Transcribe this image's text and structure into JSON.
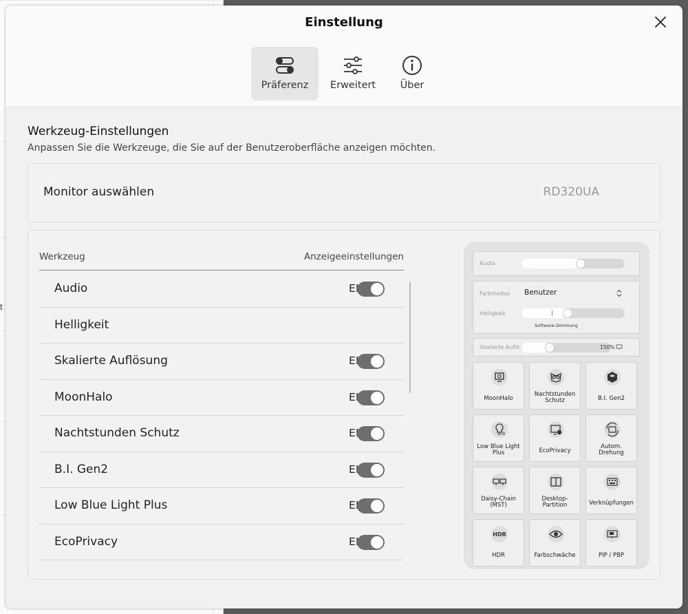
{
  "background": {
    "char": "t"
  },
  "dialog": {
    "title": "Einstellung",
    "tabs": [
      {
        "label": "Präferenz",
        "icon": "toggles-icon",
        "active": true
      },
      {
        "label": "Erweitert",
        "icon": "sliders-icon",
        "active": false
      },
      {
        "label": "Über",
        "icon": "info-icon",
        "active": false
      }
    ]
  },
  "section": {
    "title": "Werkzeug-Einstellungen",
    "subtitle": "Anpassen Sie die Werkzeuge, die Sie auf der Benutzeroberfläche anzeigen möchten."
  },
  "monitor": {
    "label": "Monitor auswählen",
    "value": "RD320UA"
  },
  "tools": {
    "header_left": "Werkzeug",
    "header_right": "Anzeigeeinstellungen",
    "rows": [
      {
        "name": "Audio",
        "state": "EIN",
        "toggle": true
      },
      {
        "name": "Helligkeit",
        "state": "",
        "toggle": false
      },
      {
        "name": "Skalierte Auflösung",
        "state": "EIN",
        "toggle": true
      },
      {
        "name": "MoonHalo",
        "state": "EIN",
        "toggle": true
      },
      {
        "name": "Nachtstunden Schutz",
        "state": "EIN",
        "toggle": true
      },
      {
        "name": "B.I. Gen2",
        "state": "EIN",
        "toggle": true
      },
      {
        "name": "Low Blue Light Plus",
        "state": "EIN",
        "toggle": true
      },
      {
        "name": "EcoPrivacy",
        "state": "EIN",
        "toggle": true
      }
    ]
  },
  "preview": {
    "audio_label": "Audio",
    "audio_level": 0.58,
    "color_mode_label": "Farbmodus",
    "color_mode_value": "Benutzer",
    "brightness_label": "Helligkeit",
    "brightness_level": 0.45,
    "software_dimming": "Software-Dimmung",
    "scaled_label": "Skalierte Auflö...",
    "scaled_value": "150%",
    "tiles": [
      {
        "label": "MoonHalo",
        "icon": "moonhalo-icon"
      },
      {
        "label": "Nachtstunden Schutz",
        "icon": "owl-icon"
      },
      {
        "label": "B.I. Gen2",
        "icon": "cube-icon"
      },
      {
        "label": "Low Blue Light Plus",
        "icon": "bulb-icon"
      },
      {
        "label": "EcoPrivacy",
        "icon": "privacy-icon"
      },
      {
        "label": "Autom. Drehung",
        "icon": "rotate-icon"
      },
      {
        "label": "Daisy-Chain (MST)",
        "icon": "daisy-chain-icon"
      },
      {
        "label": "Desktop-Partition",
        "icon": "partition-icon"
      },
      {
        "label": "Verknüpfungen",
        "icon": "keyboard-icon"
      },
      {
        "label": "HDR",
        "icon": "hdr-icon"
      },
      {
        "label": "Farbschwäche",
        "icon": "eye-icon"
      },
      {
        "label": "PIP / PBP",
        "icon": "pip-icon"
      }
    ]
  }
}
